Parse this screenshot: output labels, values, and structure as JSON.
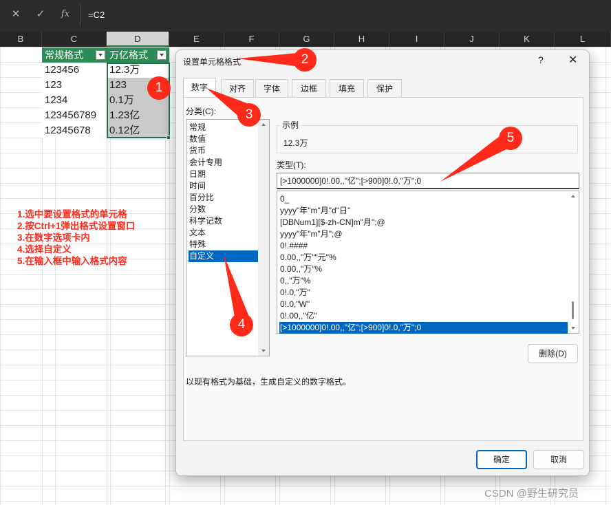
{
  "formula_bar": {
    "cancel_icon": "close-icon",
    "confirm_icon": "check-icon",
    "fx_label": "fx",
    "content": "=C2"
  },
  "columns": [
    {
      "label": "B",
      "selected": false
    },
    {
      "label": "C",
      "selected": false
    },
    {
      "label": "D",
      "selected": true
    },
    {
      "label": "E",
      "selected": false
    },
    {
      "label": "F",
      "selected": false
    },
    {
      "label": "G",
      "selected": false
    },
    {
      "label": "H",
      "selected": false
    },
    {
      "label": "I",
      "selected": false
    },
    {
      "label": "J",
      "selected": false
    },
    {
      "label": "K",
      "selected": false
    },
    {
      "label": "L",
      "selected": false
    }
  ],
  "table": {
    "headers": [
      "常规格式",
      "万亿格式"
    ],
    "rows": [
      [
        "123456",
        "12.3万"
      ],
      [
        "123",
        "123"
      ],
      [
        "1234",
        "0.1万"
      ],
      [
        "123456789",
        "1.23亿"
      ],
      [
        "12345678",
        "0.12亿"
      ]
    ]
  },
  "instructions": [
    "1.选中要设置格式的单元格",
    "2.按Ctrl+1弹出格式设置窗口",
    "3.在数字选项卡内",
    "4.选择自定义",
    "5.在输入框中输入格式内容"
  ],
  "dialog": {
    "title": "设置单元格格式",
    "help": "?",
    "close": "✕",
    "tabs": [
      "数字",
      "对齐",
      "字体",
      "边框",
      "填充",
      "保护"
    ],
    "active_tab": "数字",
    "category_label": "分类(C):",
    "categories": [
      "常规",
      "数值",
      "货币",
      "会计专用",
      "日期",
      "时间",
      "百分比",
      "分数",
      "科学记数",
      "文本",
      "特殊",
      "自定义"
    ],
    "selected_category": "自定义",
    "sample_label": "示例",
    "sample_value": "12.3万",
    "type_label": "类型(T):",
    "type_value": "[>1000000]0!.00,,\"亿\";[>900]0!.0,\"万\";0",
    "type_list": [
      "0_",
      "yyyy\"年\"m\"月\"d\"日\"",
      "[DBNum1][$-zh-CN]m\"月\";@",
      "yyyy\"年\"m\"月\";@",
      "0!.####",
      "0.00,,\"万\"\"元\"%",
      "0.00,,\"万\"%",
      "0,,\"万\"%",
      "0!.0,\"万\"",
      "0!.0,\"W\"",
      "0!.00,,\"亿\"",
      "[>1000000]0!.00,,\"亿\";[>900]0!.0,\"万\";0"
    ],
    "selected_type_index": 11,
    "delete_button": "删除(D)",
    "hint": "以现有格式为基础，生成自定义的数字格式。",
    "ok_button": "确定",
    "cancel_button": "取消"
  },
  "callouts": [
    "1",
    "2",
    "3",
    "4",
    "5"
  ],
  "accent_colors": {
    "excel_green": "#2e8b57",
    "selection_blue": "#0067c0",
    "callout_red": "#ff2a1a"
  },
  "watermark": "CSDN @野生研究员"
}
